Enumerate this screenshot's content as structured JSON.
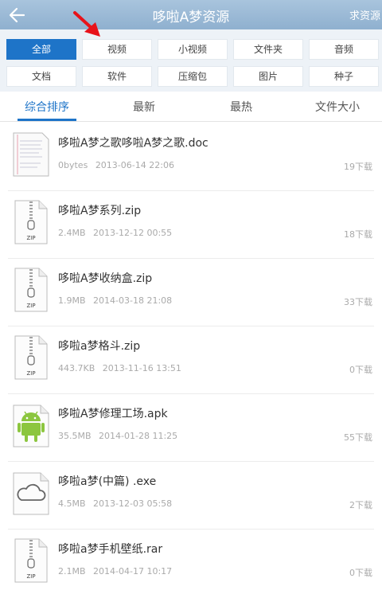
{
  "header": {
    "title": "哆啦A梦资源",
    "right_action": "求资源"
  },
  "filters": {
    "row1": [
      "全部",
      "视频",
      "小视频",
      "文件夹",
      "音频"
    ],
    "row2": [
      "文档",
      "软件",
      "压缩包",
      "图片",
      "种子"
    ],
    "active": "全部"
  },
  "sort_tabs": [
    "综合排序",
    "最新",
    "最热",
    "文件大小"
  ],
  "files": [
    {
      "name": "哆啦A梦之歌哆啦A梦之歌.doc",
      "size": "0bytes",
      "date": "2013-06-14 22:06",
      "downloads": "19下载",
      "icon": "doc"
    },
    {
      "name": "哆啦A梦系列.zip",
      "size": "2.4MB",
      "date": "2013-12-12 00:55",
      "downloads": "18下载",
      "icon": "zip"
    },
    {
      "name": "哆啦A梦收纳盒.zip",
      "size": "1.9MB",
      "date": "2014-03-18 21:08",
      "downloads": "33下载",
      "icon": "zip"
    },
    {
      "name": "哆啦a梦格斗.zip",
      "size": "443.7KB",
      "date": "2013-11-16 13:51",
      "downloads": "0下载",
      "icon": "zip"
    },
    {
      "name": "哆啦A梦修理工场.apk",
      "size": "35.5MB",
      "date": "2014-01-28 11:25",
      "downloads": "55下载",
      "icon": "apk"
    },
    {
      "name": "哆啦a梦(中篇) .exe",
      "size": "4.5MB",
      "date": "2013-12-03 05:58",
      "downloads": "2下载",
      "icon": "exe"
    },
    {
      "name": "哆啦a梦手机壁纸.rar",
      "size": "2.1MB",
      "date": "2014-04-17 10:17",
      "downloads": "0下载",
      "icon": "zip"
    }
  ],
  "icon_labels": {
    "zip": "ZIP"
  },
  "colors": {
    "accent": "#1e74c8",
    "header": "#9ab8d4",
    "annotation_arrow": "#e8121a"
  }
}
